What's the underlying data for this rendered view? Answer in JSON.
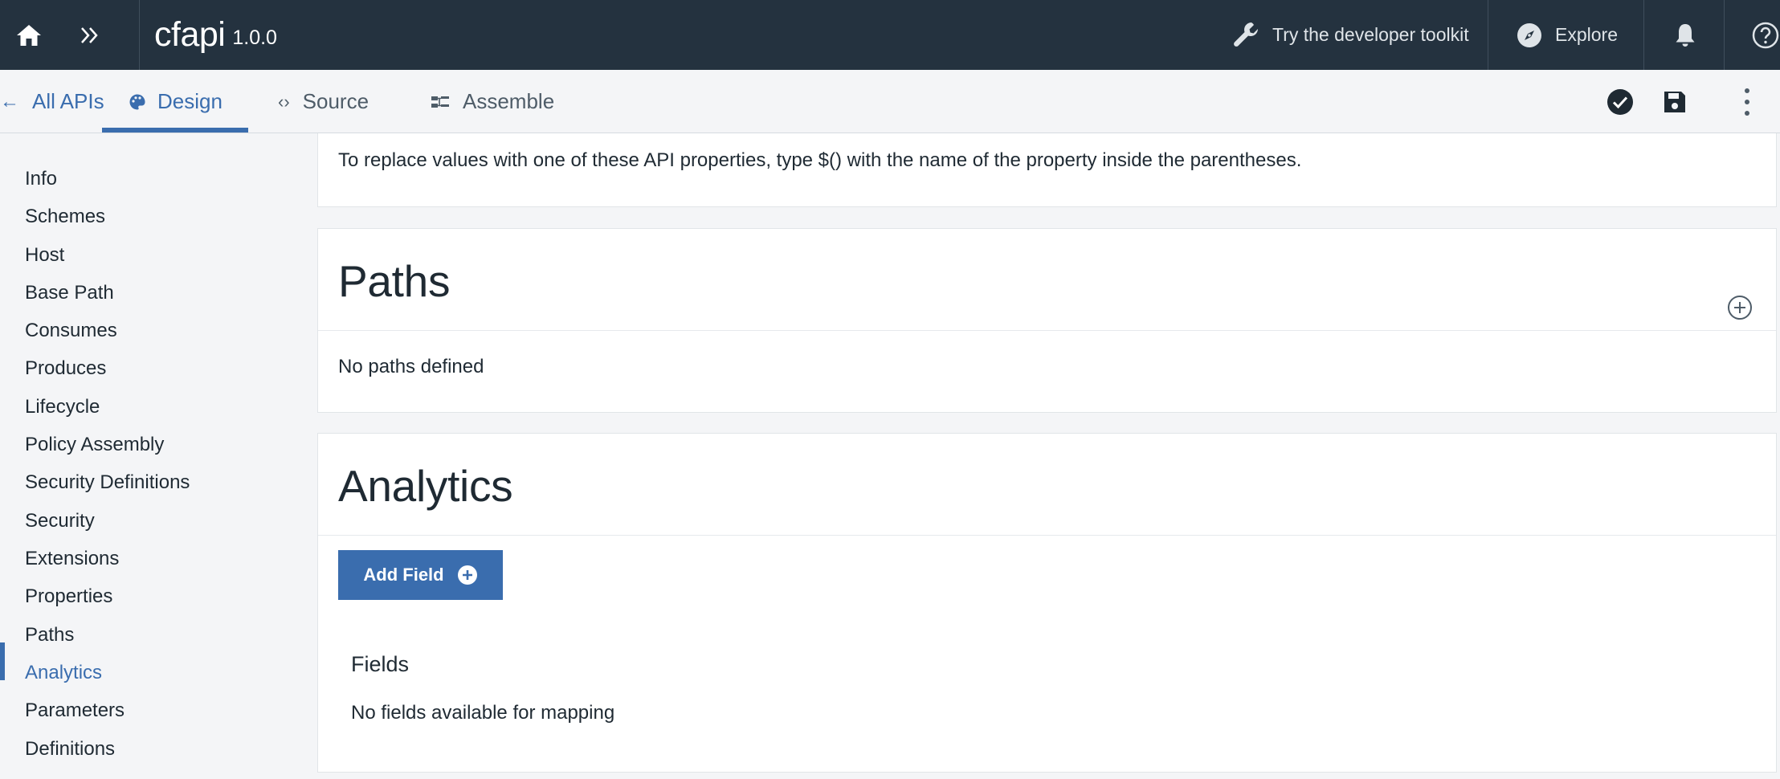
{
  "topbar": {
    "app_name": "cfapi",
    "version": "1.0.0",
    "toolkit_label": "Try the developer toolkit",
    "explore_label": "Explore",
    "bg_color": "#24323f"
  },
  "subbar": {
    "back_label": "All APIs",
    "tabs": [
      {
        "label": "Design",
        "icon": "palette-icon",
        "active": true
      },
      {
        "label": "Source",
        "icon": "code-icon",
        "active": false
      },
      {
        "label": "Assemble",
        "icon": "assemble-icon",
        "active": false
      }
    ],
    "accent_color": "#3a6dae"
  },
  "sidebar": {
    "items": [
      {
        "label": "Info"
      },
      {
        "label": "Schemes"
      },
      {
        "label": "Host"
      },
      {
        "label": "Base Path"
      },
      {
        "label": "Consumes"
      },
      {
        "label": "Produces"
      },
      {
        "label": "Lifecycle"
      },
      {
        "label": "Policy Assembly"
      },
      {
        "label": "Security Definitions"
      },
      {
        "label": "Security"
      },
      {
        "label": "Extensions"
      },
      {
        "label": "Properties"
      },
      {
        "label": "Paths"
      },
      {
        "label": "Analytics",
        "active": true
      },
      {
        "label": "Parameters"
      },
      {
        "label": "Definitions"
      }
    ]
  },
  "main": {
    "properties_hint": "To replace values with one of these API properties, type $() with the name of the property inside the parentheses.",
    "paths": {
      "title": "Paths",
      "empty_text": "No paths defined"
    },
    "analytics": {
      "title": "Analytics",
      "add_field_label": "Add Field",
      "fields_title": "Fields",
      "empty_text": "No fields available for mapping"
    }
  }
}
